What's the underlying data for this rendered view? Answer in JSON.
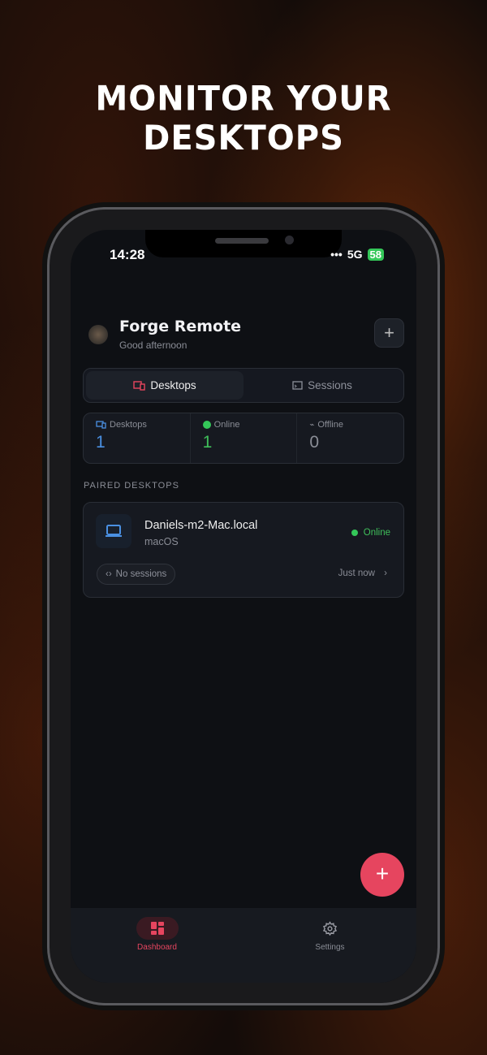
{
  "headline": "MONITOR YOUR DESKTOPS",
  "status_bar": {
    "time": "14:28",
    "network": "5G",
    "battery": "58"
  },
  "header": {
    "title": "Forge Remote",
    "subtitle": "Good afternoon",
    "add_label": "+"
  },
  "tabs": [
    {
      "label": "Desktops",
      "active": true
    },
    {
      "label": "Sessions",
      "active": false
    }
  ],
  "stats": [
    {
      "label": "Desktops",
      "value": "1",
      "color": "#4a90e2"
    },
    {
      "label": "Online",
      "value": "1",
      "color": "#3fbf5a"
    },
    {
      "label": "Offline",
      "value": "0",
      "color": "#8a8d96"
    }
  ],
  "section_title": "PAIRED DESKTOPS",
  "desktops": [
    {
      "name": "Daniels-m2-Mac.local",
      "os": "macOS",
      "status": "Online",
      "sessions": "No sessions",
      "last_seen": "Just now"
    }
  ],
  "fab_label": "+",
  "nav": [
    {
      "label": "Dashboard",
      "active": true
    },
    {
      "label": "Settings",
      "active": false
    }
  ],
  "colors": {
    "accent": "#e6455f",
    "online": "#34c759",
    "blue": "#4a90e2"
  }
}
